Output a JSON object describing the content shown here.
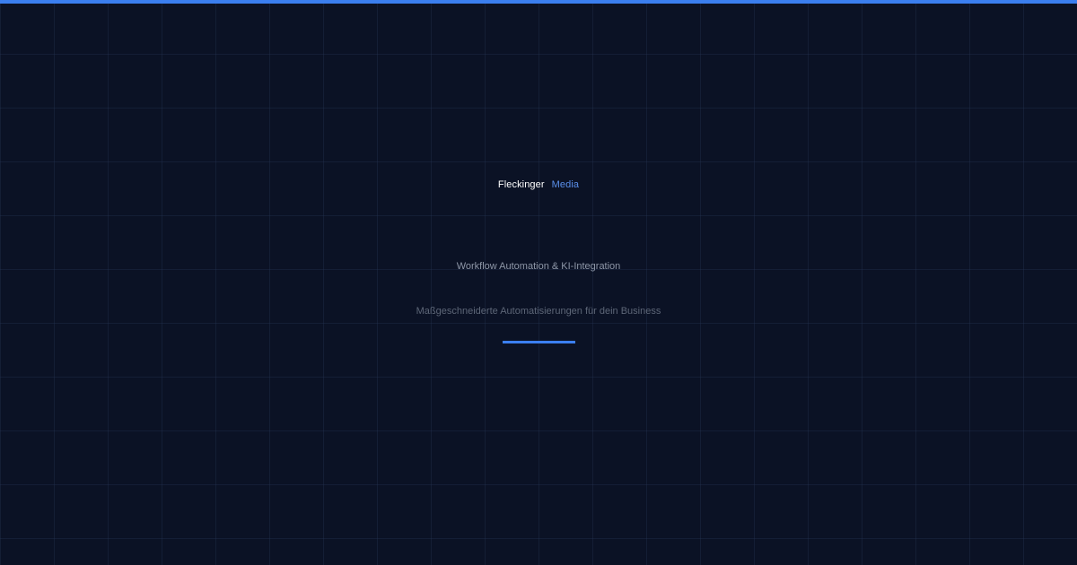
{
  "brand": {
    "name": "Fleckinger",
    "accent": "Media"
  },
  "hero": {
    "tagline": "Workflow Automation & KI-Integration",
    "subtitle": "Maßgeschneiderte Automatisierungen für dein Business"
  },
  "colors": {
    "background": "#0b1225",
    "accent": "#3b7ff0",
    "brand_accent_text": "#5a8fea",
    "tagline_text": "#8e97a8",
    "subtitle_text": "#5d6677"
  }
}
